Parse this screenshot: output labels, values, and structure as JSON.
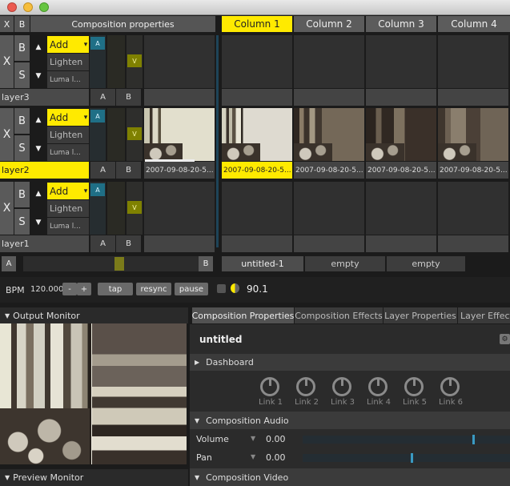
{
  "header": {
    "x_label": "X",
    "b_label": "B",
    "composition_properties": "Composition properties",
    "columns": [
      "Column 1",
      "Column 2",
      "Column 3",
      "Column 4"
    ]
  },
  "layers": [
    {
      "name": "layer3",
      "blend_options": [
        "Add",
        "Lighten",
        "Luma l..."
      ],
      "clips": [
        "",
        "",
        "",
        "",
        ""
      ]
    },
    {
      "name": "layer2",
      "blend_options": [
        "Add",
        "Lighten",
        "Luma l..."
      ],
      "clips": [
        "2007-09-08-20-5...",
        "2007-09-08-20-5...",
        "2007-09-08-20-5...",
        "2007-09-08-20-5...",
        "2007-09-08-20-5..."
      ]
    },
    {
      "name": "layer1",
      "blend_options": [
        "Add",
        "Lighten",
        "Luma l..."
      ],
      "clips": [
        "",
        "",
        "",
        "",
        ""
      ]
    }
  ],
  "layer_controls": {
    "x": "X",
    "b": "B",
    "s": "S",
    "a": "A",
    "v": "V",
    "ab_a": "A",
    "ab_b": "B",
    "up": "▲",
    "down": "▼",
    "menu": "▾"
  },
  "crossfader": {
    "a": "A",
    "b": "B",
    "position": 0.55
  },
  "deck_tabs": [
    "untitled-1",
    "empty",
    "empty"
  ],
  "transport": {
    "bpm_label": "BPM",
    "bpm_value": "120.000",
    "minus": "-",
    "plus": "+",
    "tap": "tap",
    "resync": "resync",
    "pause": "pause",
    "fps": "90.1"
  },
  "output_monitor": {
    "title": "Output Monitor"
  },
  "preview_monitor": {
    "title": "Preview Monitor"
  },
  "panel_tabs": [
    "Composition Properties",
    "Composition Effects",
    "Layer Properties",
    "Layer Effect"
  ],
  "composition": {
    "name": "untitled",
    "dashboard": "Dashboard",
    "links": [
      "Link 1",
      "Link 2",
      "Link 3",
      "Link 4",
      "Link 5",
      "Link 6"
    ],
    "audio_title": "Composition Audio",
    "volume_label": "Volume",
    "volume_value": "0.00",
    "volume_level": 0.82,
    "pan_label": "Pan",
    "pan_value": "0.00",
    "pan_level": 0.52,
    "video_title": "Composition Video"
  },
  "colors": {
    "accent": "#ffea00",
    "a_button": "#1f6f86",
    "v_button": "#7f8100"
  }
}
